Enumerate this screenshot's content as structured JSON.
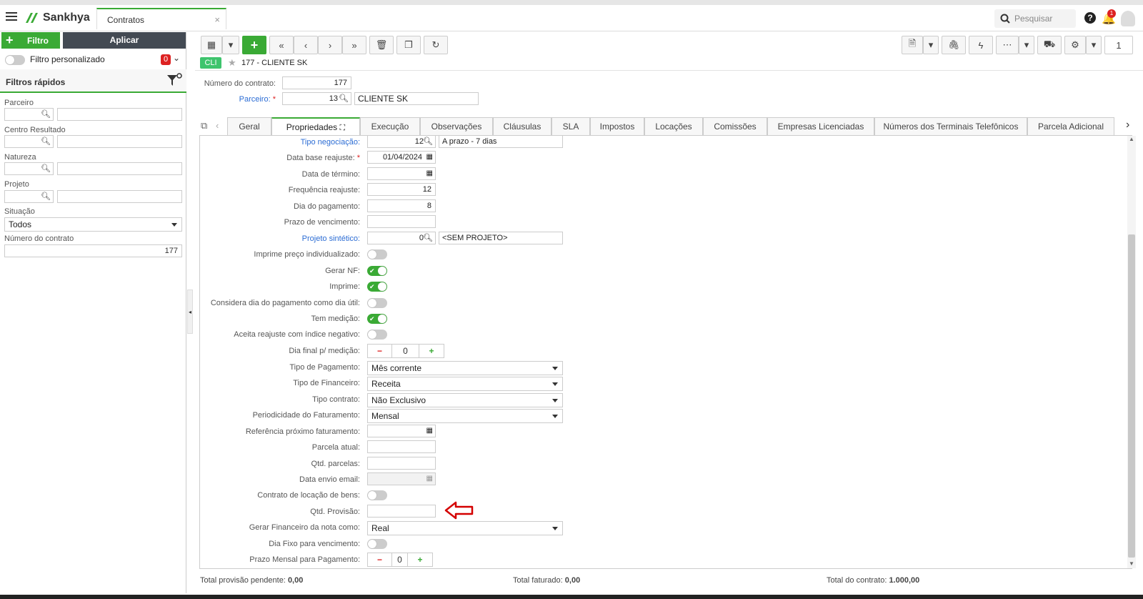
{
  "app": {
    "name": "Sankhya",
    "tab_title": "Contratos",
    "search_placeholder": "Pesquisar",
    "notif_count": "1"
  },
  "left_panel": {
    "filter_button": "Filtro",
    "apply_button": "Aplicar",
    "custom_filter_label": "Filtro personalizado",
    "custom_filter_count": "0",
    "quick_filters_title": "Filtros rápidos",
    "fields": {
      "parceiro": "Parceiro",
      "centro": "Centro Resultado",
      "natureza": "Natureza",
      "projeto": "Projeto",
      "situacao": "Situação",
      "situacao_value": "Todos",
      "numero_contrato": "Número do contrato",
      "numero_contrato_value": "177"
    }
  },
  "toolbar": {
    "page_number": "1"
  },
  "record": {
    "badge": "CLI",
    "title": "177 - CLIENTE SK"
  },
  "header_form": {
    "numero_label": "Número do contrato:",
    "numero_value": "177",
    "parceiro_label": "Parceiro:",
    "parceiro_code": "13",
    "parceiro_name": "CLIENTE SK"
  },
  "tabs": [
    "Geral",
    "Propriedades",
    "Execução",
    "Observações",
    "Cláusulas",
    "SLA",
    "Impostos",
    "Locações",
    "Comissões",
    "Empresas Licenciadas",
    "Números dos Terminais Telefônicos",
    "Parcela Adicional"
  ],
  "form": {
    "tipo_negociacao": {
      "label": "Tipo negociação:",
      "code": "12",
      "desc": "A prazo - 7 dias"
    },
    "data_base": {
      "label": "Data base reajuste:",
      "value": "01/04/2024"
    },
    "data_termino": {
      "label": "Data de término:"
    },
    "frequencia": {
      "label": "Frequência reajuste:",
      "value": "12"
    },
    "dia_pagamento": {
      "label": "Dia do pagamento:",
      "value": "8"
    },
    "prazo_vencimento": {
      "label": "Prazo de vencimento:"
    },
    "projeto_sintetico": {
      "label": "Projeto sintético:",
      "code": "0",
      "desc": "<SEM PROJETO>"
    },
    "imprime_preco": {
      "label": "Imprime preço individualizado:"
    },
    "gerar_nf": {
      "label": "Gerar NF:"
    },
    "imprime": {
      "label": "Imprime:"
    },
    "considera_dia": {
      "label": "Considera dia do pagamento como dia útil:"
    },
    "tem_medicao": {
      "label": "Tem medição:"
    },
    "aceita_reajuste": {
      "label": "Aceita reajuste com índice negativo:"
    },
    "dia_final": {
      "label": "Dia final p/ medição:",
      "value": "0"
    },
    "tipo_pagamento": {
      "label": "Tipo de Pagamento:",
      "value": "Mês corrente"
    },
    "tipo_financeiro": {
      "label": "Tipo de Financeiro:",
      "value": "Receita"
    },
    "tipo_contrato": {
      "label": "Tipo contrato:",
      "value": "Não Exclusivo"
    },
    "periodicidade": {
      "label": "Periodicidade do Faturamento:",
      "value": "Mensal"
    },
    "referencia": {
      "label": "Referência próximo faturamento:"
    },
    "parcela_atual": {
      "label": "Parcela atual:"
    },
    "qtd_parcelas": {
      "label": "Qtd. parcelas:"
    },
    "data_envio": {
      "label": "Data envio email:"
    },
    "contrato_locacao": {
      "label": "Contrato de locação de bens:"
    },
    "qtd_provisao": {
      "label": "Qtd. Provisão:"
    },
    "gerar_financeiro": {
      "label": "Gerar Financeiro da nota como:",
      "value": "Real"
    },
    "dia_fixo": {
      "label": "Dia Fixo para vencimento:"
    },
    "prazo_mensal": {
      "label": "Prazo Mensal para Pagamento:",
      "value": "0"
    }
  },
  "footer": {
    "provisao_label": "Total provisão pendente:",
    "provisao_value": "0,00",
    "faturado_label": "Total faturado:",
    "faturado_value": "0,00",
    "contrato_label": "Total do contrato:",
    "contrato_value": "1.000,00"
  },
  "colors": {
    "accent": "#3aaa35",
    "link": "#2b6cd4",
    "arrow": "#d40000"
  }
}
